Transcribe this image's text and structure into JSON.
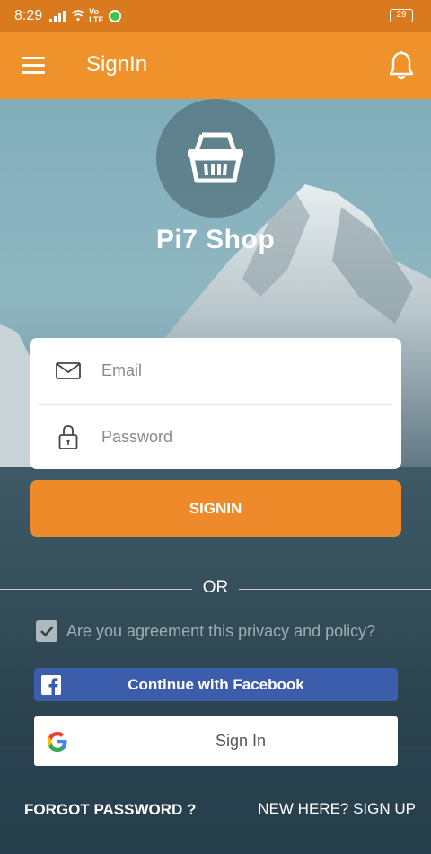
{
  "status_bar": {
    "time": "8:29",
    "network_label": "LTE",
    "volte": "Vo",
    "battery": "29"
  },
  "app_bar": {
    "title": "SignIn",
    "menu_icon": "hamburger-menu-icon",
    "notification_icon": "bell-icon",
    "background": "#f0922c"
  },
  "brand": {
    "logo_icon": "shopping-basket-icon",
    "name": "Pi7 Shop"
  },
  "form": {
    "email_placeholder": "Email",
    "email_value": "",
    "password_placeholder": "Password",
    "password_value": "",
    "submit_label": "SIGNIN",
    "submit_color": "#ee8a2a"
  },
  "divider_text": "OR",
  "agreement": {
    "checked": true,
    "label": "Are you agreement this privacy and policy?"
  },
  "social": {
    "facebook_label": "Continue with Facebook",
    "facebook_color": "#3b5dab",
    "google_label": "Sign In"
  },
  "footer": {
    "forgot_label": "FORGOT PASSWORD ?",
    "signup_label": "NEW HERE? SIGN UP"
  }
}
